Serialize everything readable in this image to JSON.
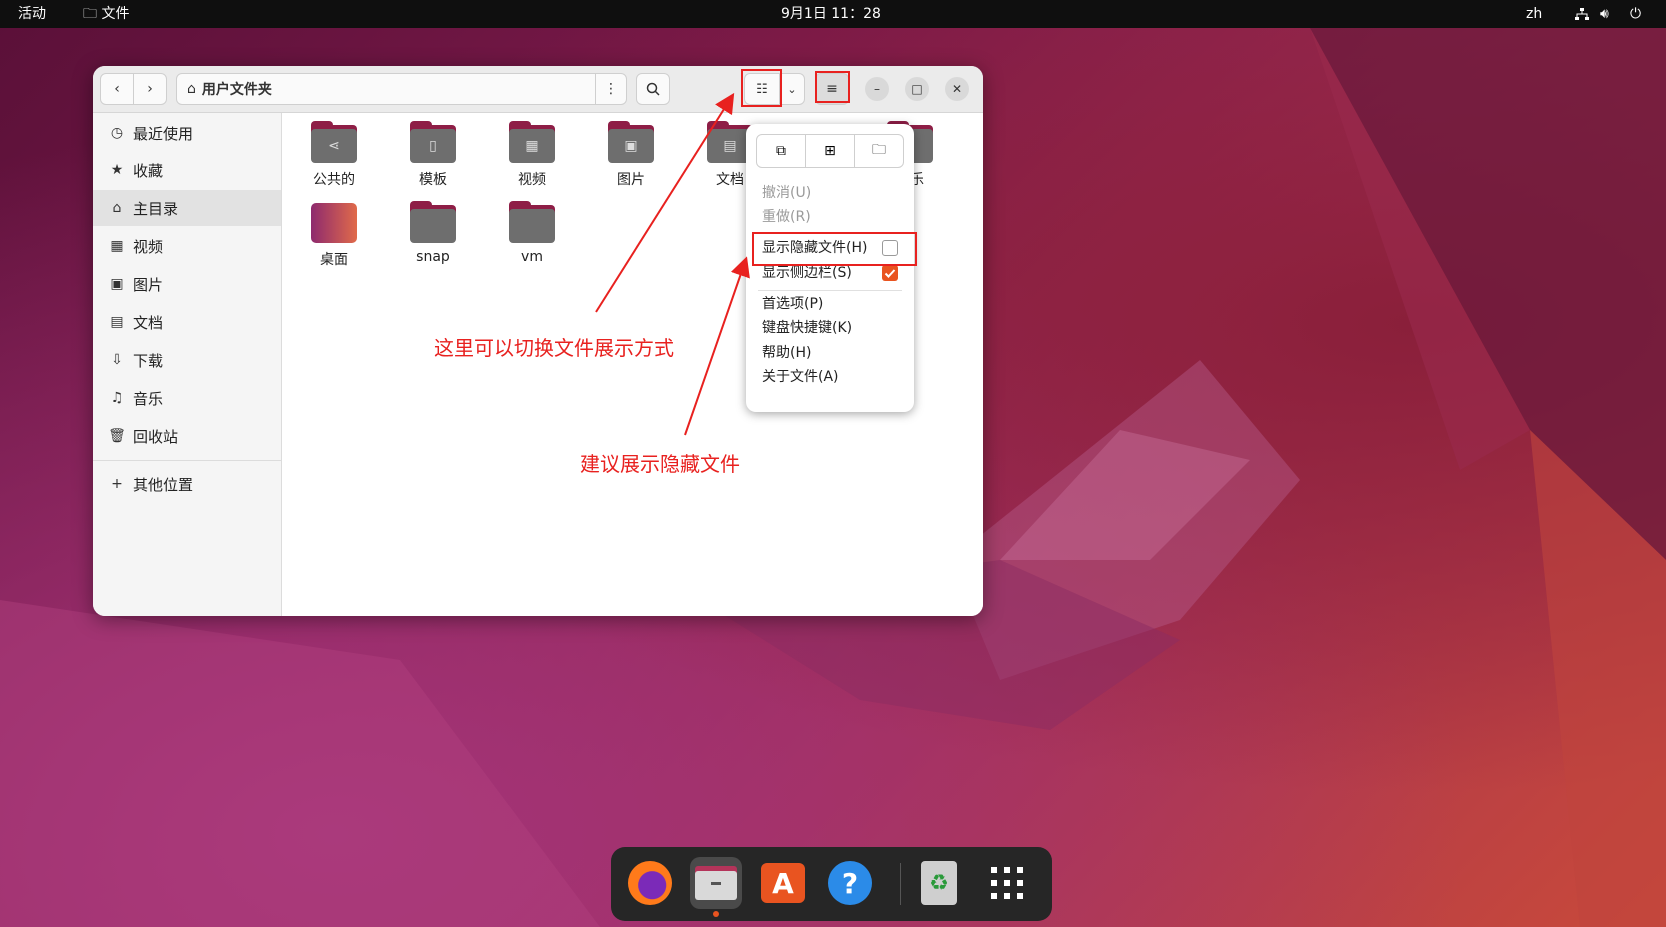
{
  "topbar": {
    "activities": "活动",
    "app_name": "文件",
    "clock": "9月1日  11：28",
    "lang": "zh"
  },
  "window": {
    "location": "用户文件夹"
  },
  "sidebar": {
    "items": [
      {
        "label": "最近使用",
        "icon": "clock-icon"
      },
      {
        "label": "收藏",
        "icon": "star-icon"
      },
      {
        "label": "主目录",
        "icon": "home-icon"
      },
      {
        "label": "视频",
        "icon": "video-icon"
      },
      {
        "label": "图片",
        "icon": "image-icon"
      },
      {
        "label": "文档",
        "icon": "document-icon"
      },
      {
        "label": "下载",
        "icon": "download-icon"
      },
      {
        "label": "音乐",
        "icon": "music-icon"
      },
      {
        "label": "回收站",
        "icon": "trash-icon"
      },
      {
        "label": "其他位置",
        "icon": "plus-icon"
      }
    ]
  },
  "files": [
    {
      "name": "公共的",
      "icon": "share-icon"
    },
    {
      "name": "模板",
      "icon": "template-icon"
    },
    {
      "name": "视频",
      "icon": "video-icon"
    },
    {
      "name": "图片",
      "icon": "image-icon"
    },
    {
      "name": "文档",
      "icon": "document-icon"
    },
    {
      "name": "音乐",
      "icon": "music-icon"
    },
    {
      "name": "桌面",
      "icon": "desktop-folder-icon"
    },
    {
      "name": "snap",
      "icon": "folder-icon"
    },
    {
      "name": "vm",
      "icon": "folder-icon"
    }
  ],
  "menu": {
    "undo": "撤消(U)",
    "redo": "重做(R)",
    "show_hidden": "显示隐藏文件(H)",
    "show_hidden_checked": false,
    "show_sidebar": "显示侧边栏(S)",
    "show_sidebar_checked": true,
    "preferences": "首选项(P)",
    "shortcuts": "键盘快捷键(K)",
    "help": "帮助(H)",
    "about": "关于文件(A)"
  },
  "annotations": {
    "view_switch": "这里可以切换文件展示方式",
    "show_hidden_tip": "建议展示隐藏文件",
    "color": "#e8211f"
  },
  "dock": {
    "apps": [
      "firefox-icon",
      "files-icon",
      "app-center-icon",
      "help-icon",
      "trash-icon",
      "app-grid-icon"
    ]
  }
}
